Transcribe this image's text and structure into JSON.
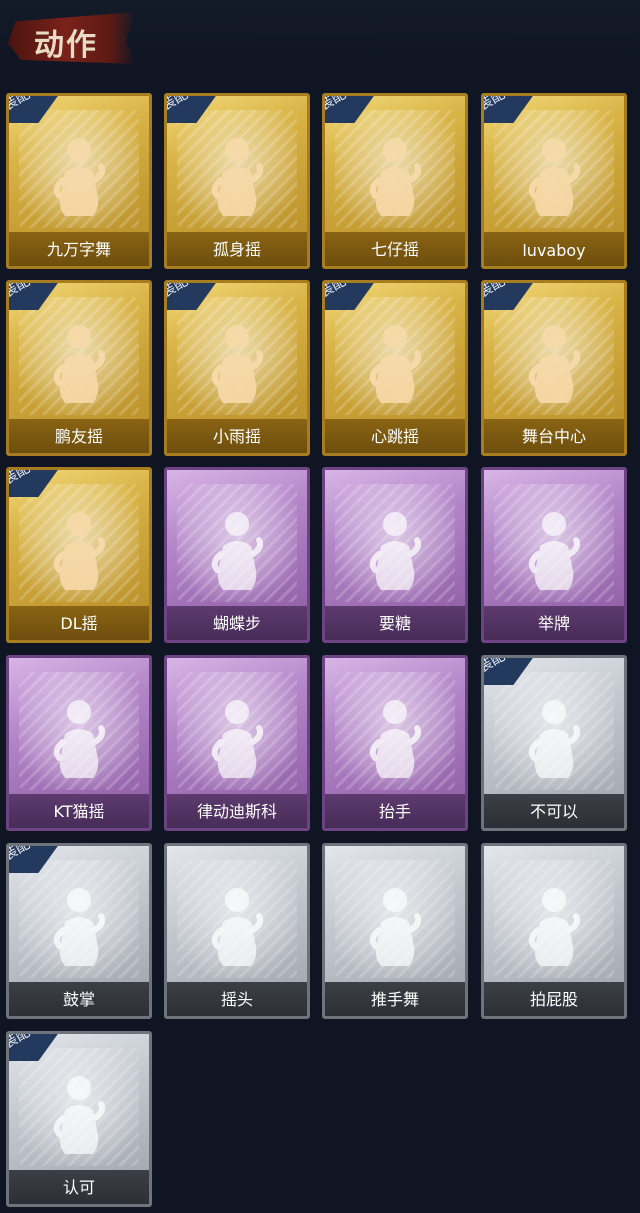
{
  "header": {
    "title": "动作"
  },
  "badge_text": "装配",
  "colors": {
    "gold": "#d9b447",
    "purple": "#b487c9",
    "gray": "#c3c8cf",
    "background": "#0f1522"
  },
  "cards": [
    {
      "label": "九万字舞",
      "rarity": "gold",
      "equipped": true,
      "icon": "dance-pose-icon"
    },
    {
      "label": "孤身摇",
      "rarity": "gold",
      "equipped": true,
      "icon": "dance-pose-icon"
    },
    {
      "label": "七仔摇",
      "rarity": "gold",
      "equipped": true,
      "icon": "dance-pose-icon"
    },
    {
      "label": "luvaboy",
      "rarity": "gold",
      "equipped": true,
      "icon": "dance-pose-icon"
    },
    {
      "label": "鹏友摇",
      "rarity": "gold",
      "equipped": true,
      "icon": "dance-pose-icon"
    },
    {
      "label": "小雨摇",
      "rarity": "gold",
      "equipped": true,
      "icon": "dance-pose-icon"
    },
    {
      "label": "心跳摇",
      "rarity": "gold",
      "equipped": true,
      "icon": "dance-pose-icon"
    },
    {
      "label": "舞台中心",
      "rarity": "gold",
      "equipped": true,
      "icon": "dance-pose-icon"
    },
    {
      "label": "DL摇",
      "rarity": "gold",
      "equipped": true,
      "icon": "dance-pose-icon"
    },
    {
      "label": "蝴蝶步",
      "rarity": "purple",
      "equipped": false,
      "icon": "dance-pose-icon"
    },
    {
      "label": "要糖",
      "rarity": "purple",
      "equipped": false,
      "icon": "reach-pose-icon"
    },
    {
      "label": "举牌",
      "rarity": "purple",
      "equipped": false,
      "icon": "sign-pose-icon"
    },
    {
      "label": "KT猫摇",
      "rarity": "purple",
      "equipped": false,
      "icon": "dance-pose-icon"
    },
    {
      "label": "律动迪斯科",
      "rarity": "purple",
      "equipped": false,
      "icon": "dance-pose-icon"
    },
    {
      "label": "抬手",
      "rarity": "purple",
      "equipped": false,
      "icon": "raise-hand-icon"
    },
    {
      "label": "不可以",
      "rarity": "gray",
      "equipped": true,
      "icon": "finger-wag-icon"
    },
    {
      "label": "鼓掌",
      "rarity": "gray",
      "equipped": true,
      "icon": "clap-icon"
    },
    {
      "label": "摇头",
      "rarity": "gray",
      "equipped": false,
      "icon": "head-shake-icon"
    },
    {
      "label": "推手舞",
      "rarity": "gray",
      "equipped": false,
      "icon": "push-dance-icon"
    },
    {
      "label": "拍屁股",
      "rarity": "gray",
      "equipped": false,
      "icon": "pat-pose-icon"
    },
    {
      "label": "认可",
      "rarity": "gray",
      "equipped": true,
      "icon": "thumbs-up-icon"
    }
  ]
}
